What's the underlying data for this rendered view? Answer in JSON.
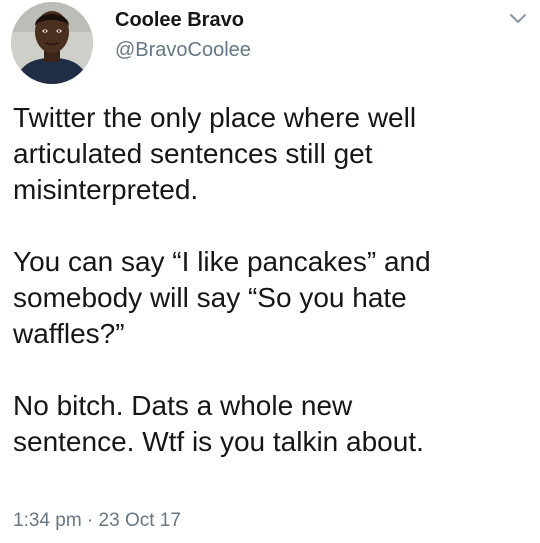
{
  "user": {
    "display_name": "Coolee Bravo",
    "handle": "@BravoCoolee"
  },
  "icons": {
    "menu": "chevron-down-icon",
    "avatar": "avatar"
  },
  "tweet": {
    "paragraphs": [
      "Twitter the only place where well\narticulated sentences still get\nmisinterpreted.",
      "You can say “I like pancakes” and\nsomebody will say “So you hate\nwaffles?”",
      "No bitch. Dats a whole new\nsentence. Wtf is you talkin about."
    ],
    "timestamp": "1:34 pm · 23 Oct 17"
  },
  "colors": {
    "text": "#14171a",
    "secondary": "#657786",
    "background": "#ffffff"
  }
}
